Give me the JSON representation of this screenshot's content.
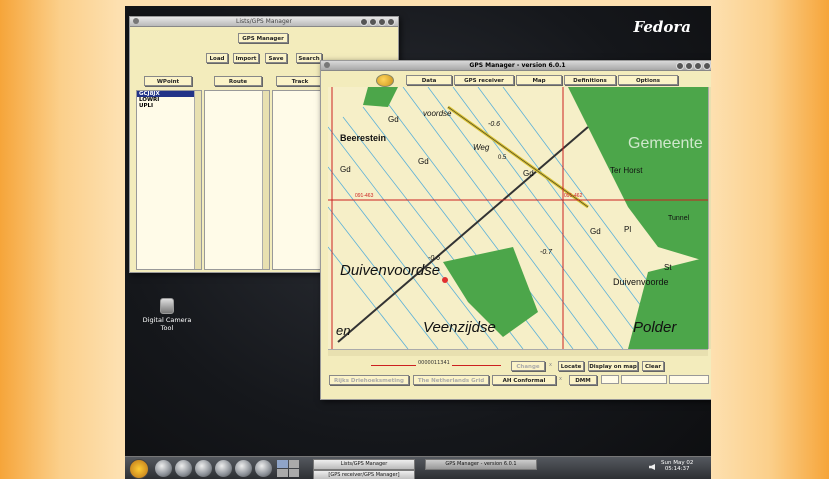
{
  "brand": {
    "name": "Fedora",
    "sub": ""
  },
  "desktop_icon": {
    "label_line1": "Digital Camera",
    "label_line2": "Tool"
  },
  "lists_window": {
    "title": "Lists/GPS Manager",
    "header_button": "GPS Manager",
    "buttons": {
      "load": "Load",
      "import": "Import",
      "save": "Save",
      "search": "Search"
    },
    "columns": {
      "wpoint": "WPoint",
      "route": "Route",
      "track": "Track"
    },
    "waypoints": [
      "GCJ8JX",
      "LOWRI",
      "UPLI"
    ]
  },
  "gps_window": {
    "title": "GPS Manager - version 6.0.1",
    "menu": {
      "data": "Data",
      "gps_receiver": "GPS receiver",
      "map": "Map",
      "definitions": "Definitions",
      "options": "Options"
    },
    "scale_text": "0000011341",
    "buttons": {
      "change": "Change",
      "locate": "Locate",
      "display_on_map": "Display on map",
      "clear": "Clear",
      "datum": "Rijks Driehoeksmeting",
      "grid": "The Netherlands Grid",
      "projection": "AH Conformal",
      "format": "DMM"
    },
    "separator": "x"
  },
  "map_labels": {
    "duivenvoorde": "Duivenvoordse",
    "veenzijdse": "Veenzijdse",
    "polder": "Polder",
    "en": "en",
    "beerestein": "Beerestein",
    "gemeente": "Gemeente",
    "ter_horst": "Ter Horst",
    "tunnel": "Tunnel",
    "duivenvoorde2": "Duivenvoorde",
    "weg": "Weg",
    "voordse": "voordse",
    "gd": "Gd",
    "pl": "Pl",
    "st": "St",
    "elev1": "-0.6",
    "elev2": "-0.7",
    "elev3": "-0.6",
    "elev4": "0.5",
    "grid1": "091-463",
    "grid2": "091-462"
  },
  "taskbar": {
    "task1": "Lists/GPS Manager",
    "task2": "GPS Manager - version 6.0.1",
    "task3": "[GPS receiver/GPS Manager]",
    "clock_date": "Sun May 02",
    "clock_time": "05:14:37"
  },
  "colors": {
    "window_bg": "#f3ecbc",
    "map_bg": "#f6efc8",
    "map_green": "#4ca64a",
    "grid_red": "#cc2020",
    "selection": "#223388"
  }
}
